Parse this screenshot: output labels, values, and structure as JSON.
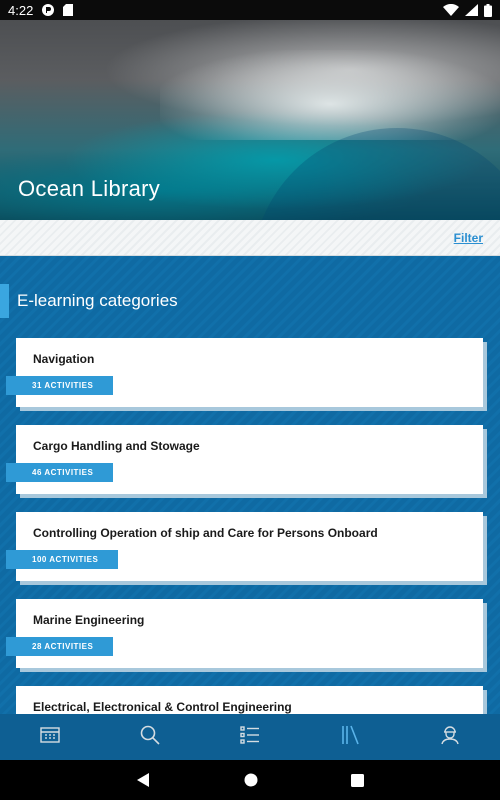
{
  "status_bar": {
    "time": "4:22",
    "icons": [
      "app-notification-icon",
      "sd-card-icon",
      "wifi-icon",
      "cell-signal-icon",
      "battery-icon"
    ]
  },
  "hero": {
    "title": "Ocean Library"
  },
  "filter": {
    "label": "Filter"
  },
  "section": {
    "title": "E-learning categories"
  },
  "categories": [
    {
      "title": "Navigation",
      "badge": "31 ACTIVITIES"
    },
    {
      "title": "Cargo Handling and Stowage",
      "badge": "46 ACTIVITIES"
    },
    {
      "title": "Controlling Operation of ship and Care for Persons Onboard",
      "badge": "100 ACTIVITIES"
    },
    {
      "title": "Marine Engineering",
      "badge": "28 ACTIVITIES"
    },
    {
      "title": "Electrical, Electronical & Control Engineering",
      "badge": ""
    }
  ],
  "bottom_nav": {
    "items": [
      "dashboard-icon",
      "search-icon",
      "list-icon",
      "library-icon",
      "profile-icon"
    ],
    "active": "library-icon"
  },
  "colors": {
    "accent": "#2f9ad6",
    "brand_blue": "#0f6aa3",
    "nav_blue": "#0e5f93",
    "active_icon": "#5ab4ea"
  }
}
